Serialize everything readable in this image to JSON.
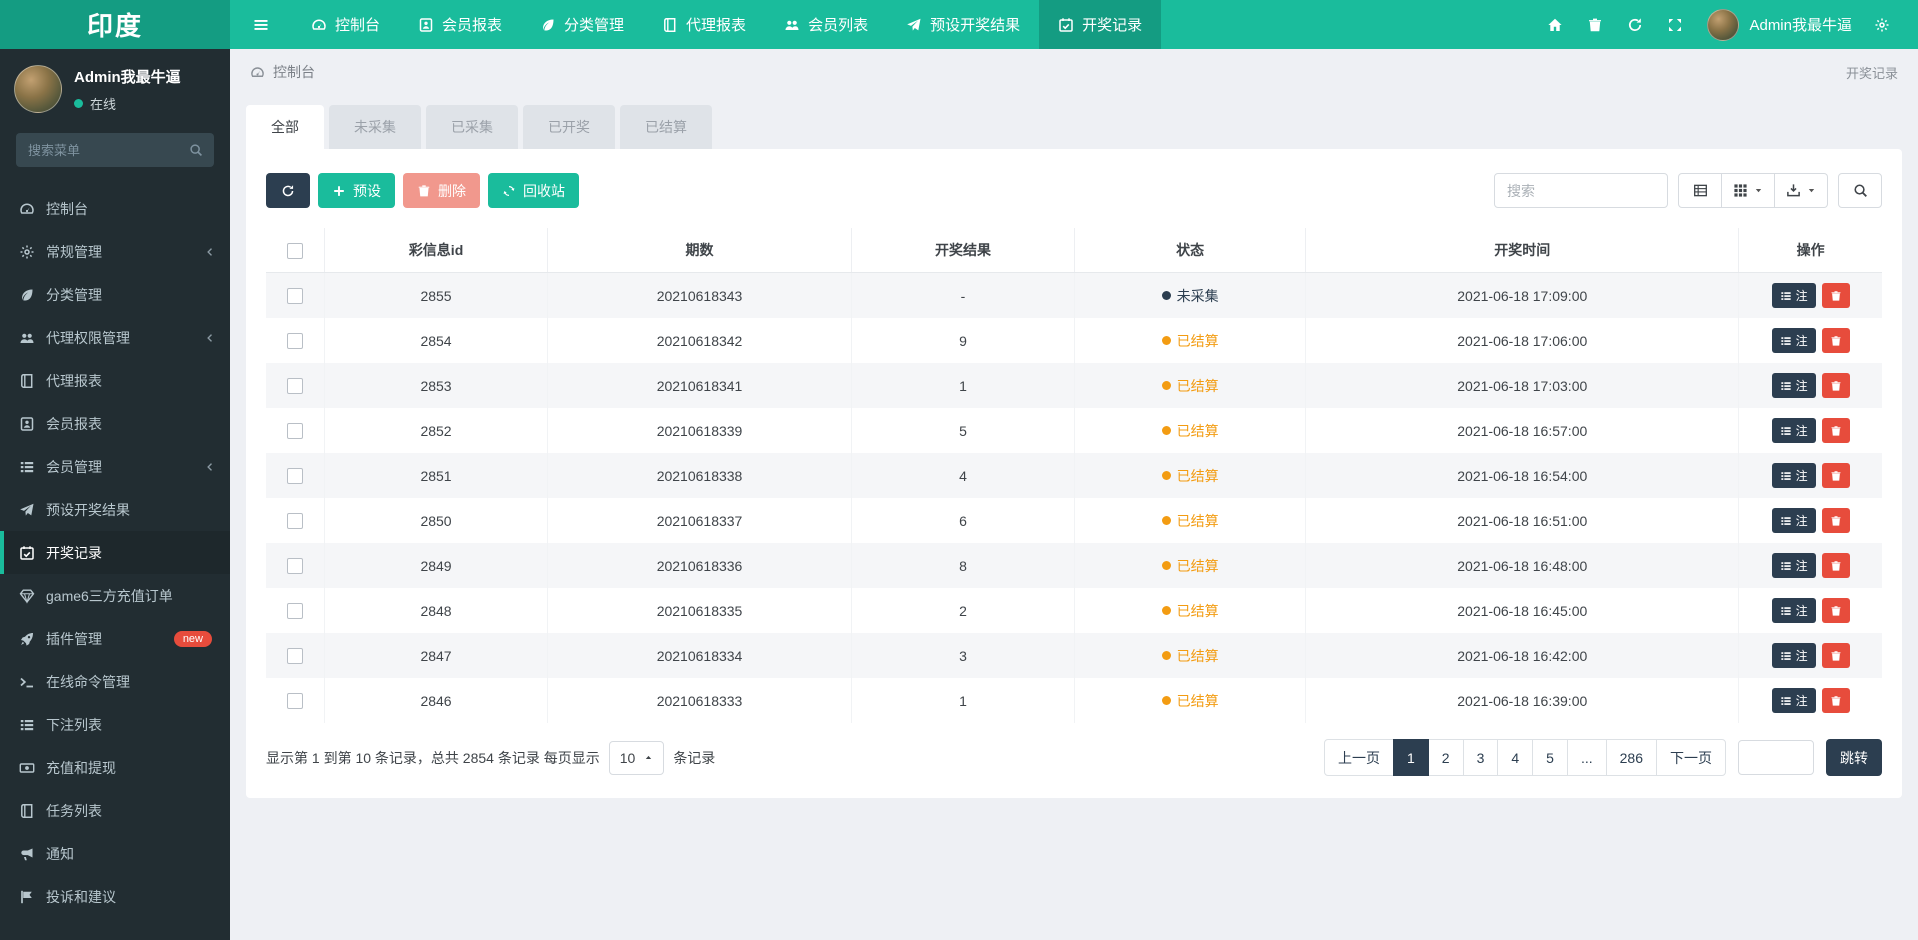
{
  "brand": {
    "logo_text": "印度"
  },
  "topnav": {
    "items": [
      {
        "label": "控制台",
        "icon": "gauge"
      },
      {
        "label": "会员报表",
        "icon": "id-card"
      },
      {
        "label": "分类管理",
        "icon": "leaf"
      },
      {
        "label": "代理报表",
        "icon": "book"
      },
      {
        "label": "会员列表",
        "icon": "users"
      },
      {
        "label": "预设开奖结果",
        "icon": "send"
      },
      {
        "label": "开奖记录",
        "icon": "calendar-check",
        "active": true
      }
    ],
    "right_icons": [
      "home",
      "trash",
      "sync",
      "expand"
    ],
    "user_name": "Admin我最牛逼"
  },
  "sidebar": {
    "user_name": "Admin我最牛逼",
    "user_status": "在线",
    "search_placeholder": "搜索菜单",
    "items": [
      {
        "label": "控制台",
        "icon": "gauge"
      },
      {
        "label": "常规管理",
        "icon": "cogs",
        "expandable": true
      },
      {
        "label": "分类管理",
        "icon": "leaf"
      },
      {
        "label": "代理权限管理",
        "icon": "users",
        "expandable": true
      },
      {
        "label": "代理报表",
        "icon": "book"
      },
      {
        "label": "会员报表",
        "icon": "id-card"
      },
      {
        "label": "会员管理",
        "icon": "list",
        "expandable": true
      },
      {
        "label": "预设开奖结果",
        "icon": "send"
      },
      {
        "label": "开奖记录",
        "icon": "calendar-check",
        "active": true
      },
      {
        "label": "game6三方充值订单",
        "icon": "gem"
      },
      {
        "label": "插件管理",
        "icon": "rocket",
        "badge": "new"
      },
      {
        "label": "在线命令管理",
        "icon": "terminal"
      },
      {
        "label": "下注列表",
        "icon": "list"
      },
      {
        "label": "充值和提现",
        "icon": "money"
      },
      {
        "label": "任务列表",
        "icon": "book"
      },
      {
        "label": "通知",
        "icon": "bullhorn"
      },
      {
        "label": "投诉和建议",
        "icon": "flag"
      }
    ]
  },
  "breadcrumb": {
    "left": "控制台",
    "right": "开奖记录"
  },
  "tabs": [
    {
      "label": "全部",
      "active": true
    },
    {
      "label": "未采集"
    },
    {
      "label": "已采集"
    },
    {
      "label": "已开奖"
    },
    {
      "label": "已结算"
    }
  ],
  "toolbar": {
    "preset_label": "预设",
    "delete_label": "删除",
    "recycle_label": "回收站",
    "search_placeholder": "搜索"
  },
  "table": {
    "columns": [
      "彩信息id",
      "期数",
      "开奖结果",
      "状态",
      "开奖时间",
      "操作"
    ],
    "note_label": "注",
    "rows": [
      {
        "id": "2855",
        "issue": "20210618343",
        "result": "-",
        "status": "未采集",
        "status_color": "#2c3e50",
        "time": "2021-06-18 17:09:00"
      },
      {
        "id": "2854",
        "issue": "20210618342",
        "result": "9",
        "status": "已结算",
        "status_color": "#f39c12",
        "time": "2021-06-18 17:06:00"
      },
      {
        "id": "2853",
        "issue": "20210618341",
        "result": "1",
        "status": "已结算",
        "status_color": "#f39c12",
        "time": "2021-06-18 17:03:00"
      },
      {
        "id": "2852",
        "issue": "20210618339",
        "result": "5",
        "status": "已结算",
        "status_color": "#f39c12",
        "time": "2021-06-18 16:57:00"
      },
      {
        "id": "2851",
        "issue": "20210618338",
        "result": "4",
        "status": "已结算",
        "status_color": "#f39c12",
        "time": "2021-06-18 16:54:00"
      },
      {
        "id": "2850",
        "issue": "20210618337",
        "result": "6",
        "status": "已结算",
        "status_color": "#f39c12",
        "time": "2021-06-18 16:51:00"
      },
      {
        "id": "2849",
        "issue": "20210618336",
        "result": "8",
        "status": "已结算",
        "status_color": "#f39c12",
        "time": "2021-06-18 16:48:00"
      },
      {
        "id": "2848",
        "issue": "20210618335",
        "result": "2",
        "status": "已结算",
        "status_color": "#f39c12",
        "time": "2021-06-18 16:45:00"
      },
      {
        "id": "2847",
        "issue": "20210618334",
        "result": "3",
        "status": "已结算",
        "status_color": "#f39c12",
        "time": "2021-06-18 16:42:00"
      },
      {
        "id": "2846",
        "issue": "20210618333",
        "result": "1",
        "status": "已结算",
        "status_color": "#f39c12",
        "time": "2021-06-18 16:39:00"
      }
    ]
  },
  "pagination": {
    "summary_prefix": "显示第 1 到第 10 条记录，总共 2854 条记录 每页显示",
    "page_size": "10",
    "summary_suffix": "条记录",
    "pages": [
      {
        "label": "上一页"
      },
      {
        "label": "1",
        "active": true
      },
      {
        "label": "2"
      },
      {
        "label": "3"
      },
      {
        "label": "4"
      },
      {
        "label": "5"
      },
      {
        "label": "..."
      },
      {
        "label": "286"
      },
      {
        "label": "下一页"
      }
    ],
    "jump_label": "跳转"
  },
  "colors": {
    "accent": "#1abc9c",
    "accent_dark": "#149c82",
    "navy": "#2c3e50",
    "danger": "#e74c3c",
    "warning": "#f39c12",
    "delete_muted": "#f1988d"
  }
}
